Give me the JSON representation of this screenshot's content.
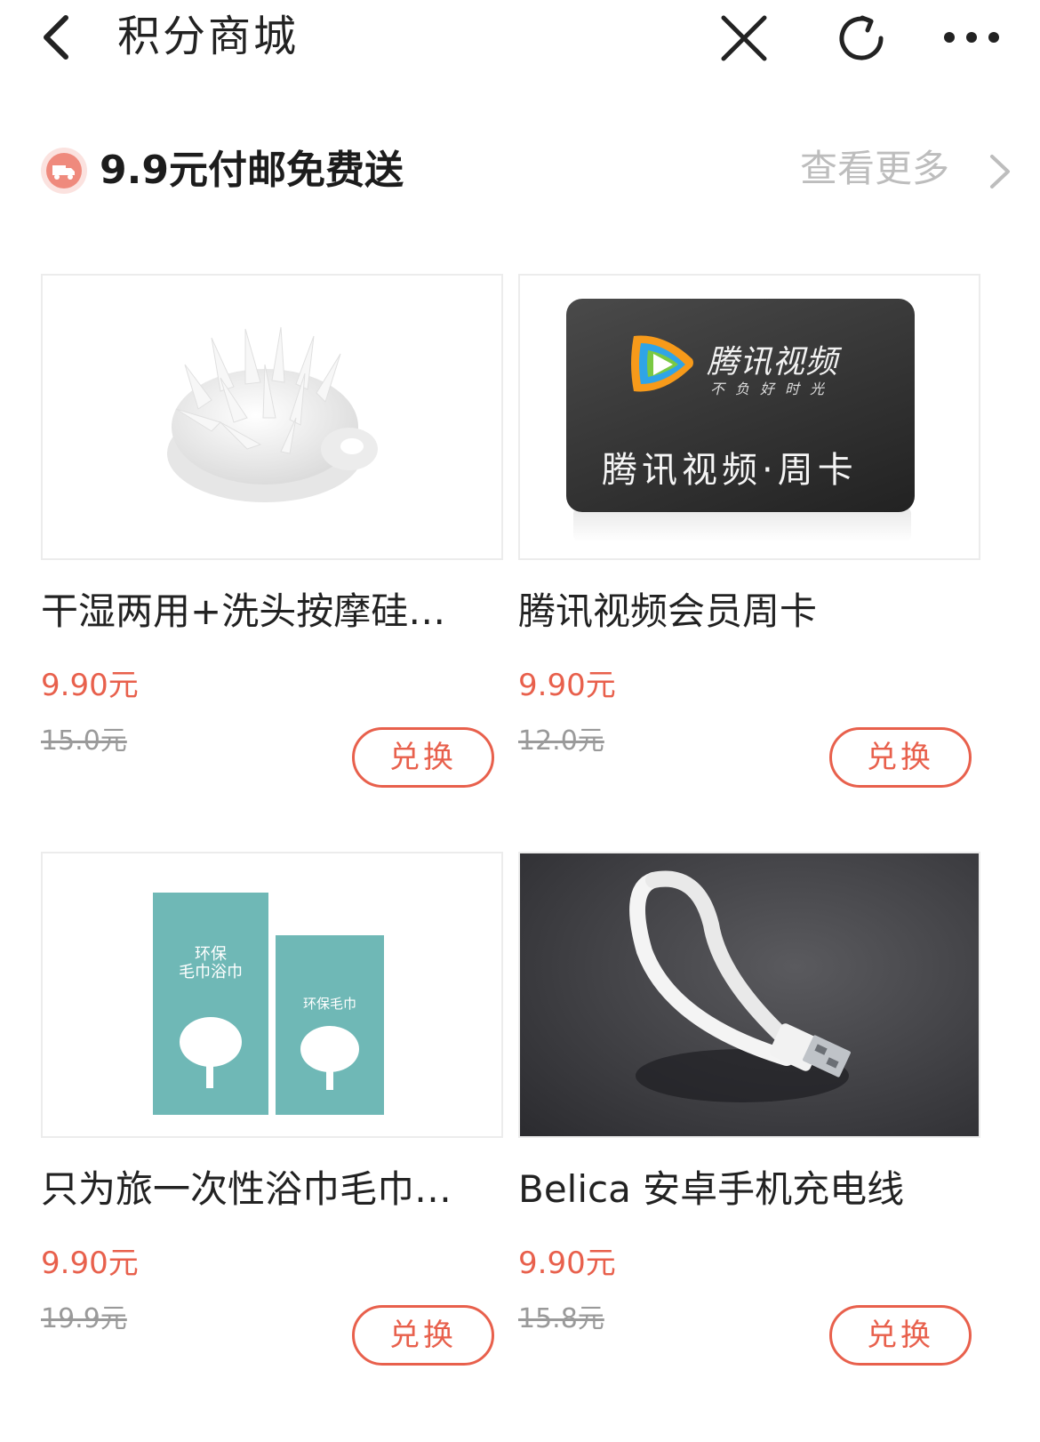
{
  "topbar": {
    "title": "积分商城",
    "icons": [
      "back-icon",
      "close-icon",
      "refresh-icon",
      "more-icon"
    ]
  },
  "section": {
    "title": "9.9元付邮免费送",
    "more_link": "查看更多",
    "icon": "truck-icon"
  },
  "products": [
    {
      "name": "干湿两用+洗头按摩硅…",
      "price": "9.90元",
      "original_price": "15.0元",
      "button": "兑换"
    },
    {
      "name": "腾讯视频会员周卡",
      "price": "9.90元",
      "original_price": "12.0元",
      "button": "兑换",
      "image_text": {
        "brand": "腾讯视频",
        "slogan": "不负好时光",
        "card_title": "腾讯视频·周卡"
      }
    },
    {
      "name": "只为旅一次性浴巾毛巾…",
      "price": "9.90元",
      "original_price": "19.9元",
      "button": "兑换",
      "image_text": {
        "large_pack": "环保\n毛巾浴巾",
        "small_pack": "环保毛巾"
      }
    },
    {
      "name": "Belica 安卓手机充电线",
      "price": "9.90元",
      "original_price": "15.8元",
      "button": "兑换"
    }
  ],
  "colors": {
    "accent": "#e8604c",
    "muted": "#9a9a9a",
    "link_gray": "#bdbdbd"
  }
}
